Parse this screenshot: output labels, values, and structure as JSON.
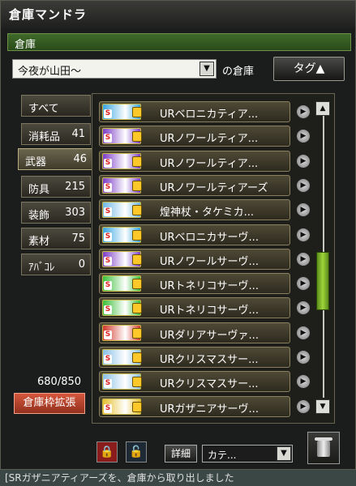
{
  "window": {
    "title": "倉庫マンドラ",
    "section_label": "倉庫"
  },
  "warehouse_select": {
    "value": "今夜が山田～",
    "suffix": "の倉庫"
  },
  "tag_button": {
    "label": "タグ▲"
  },
  "tabs": [
    {
      "label": "すべて",
      "count": ""
    },
    {
      "label": "消耗品",
      "count": "41"
    },
    {
      "label": "武器",
      "count": "46"
    },
    {
      "label": "防具",
      "count": "215"
    },
    {
      "label": "装飾",
      "count": "303"
    },
    {
      "label": "素材",
      "count": "75"
    },
    {
      "label": "ｱﾊﾞｺﾚ",
      "count": "0"
    }
  ],
  "items": [
    {
      "name": "URベロニカティア...",
      "color": "#39a6e0"
    },
    {
      "name": "URノワールティア...",
      "color": "#7b3cc7"
    },
    {
      "name": "URノワールティア...",
      "color": "#7b3cc7"
    },
    {
      "name": "URノワールティアーズ",
      "color": "#7b3cc7"
    },
    {
      "name": "煌神杖・タケミカ...",
      "color": "#6fb8e6"
    },
    {
      "name": "URベロニカサーヴ...",
      "color": "#39a6e0"
    },
    {
      "name": "URノワールサーヴ...",
      "color": "#7b3cc7"
    },
    {
      "name": "URトネリコサーヴ...",
      "color": "#3cbf3a"
    },
    {
      "name": "URトネリコサーヴ...",
      "color": "#3cbf3a"
    },
    {
      "name": "URダリアサーヴァ...",
      "color": "#d2382c"
    },
    {
      "name": "URクリスマスサー...",
      "color": "#8ac0e6"
    },
    {
      "name": "URクリスマスサー...",
      "color": "#8ac0e6"
    },
    {
      "name": "URガザニアサーヴ...",
      "color": "#e6c030"
    }
  ],
  "capacity": "680/850",
  "expand_button": "倉庫枠拡張",
  "bottom": {
    "detail_label": "詳細",
    "sort_value": "カテ..."
  },
  "status_message": "[SRガザニアティアーズを、倉庫から取り出しました"
}
